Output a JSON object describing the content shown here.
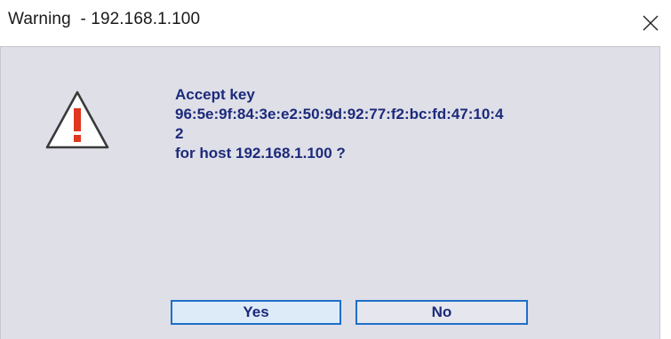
{
  "window": {
    "title": "Warning  - 192.168.1.100",
    "close_icon": "close-icon"
  },
  "dialog": {
    "icon": "warning-icon",
    "message_lines": [
      "Accept key",
      "96:5e:9f:84:3e:e2:50:9d:92:77:f2:bc:fd:47:10:4",
      "2",
      "for host 192.168.1.100 ?"
    ],
    "buttons": {
      "yes_label": "Yes",
      "no_label": "No"
    }
  },
  "colors": {
    "text_accent": "#1c2a7a",
    "button_border": "#1e6fc8",
    "dialog_bg": "#dfdfe8",
    "warning_mark": "#e0371f"
  }
}
